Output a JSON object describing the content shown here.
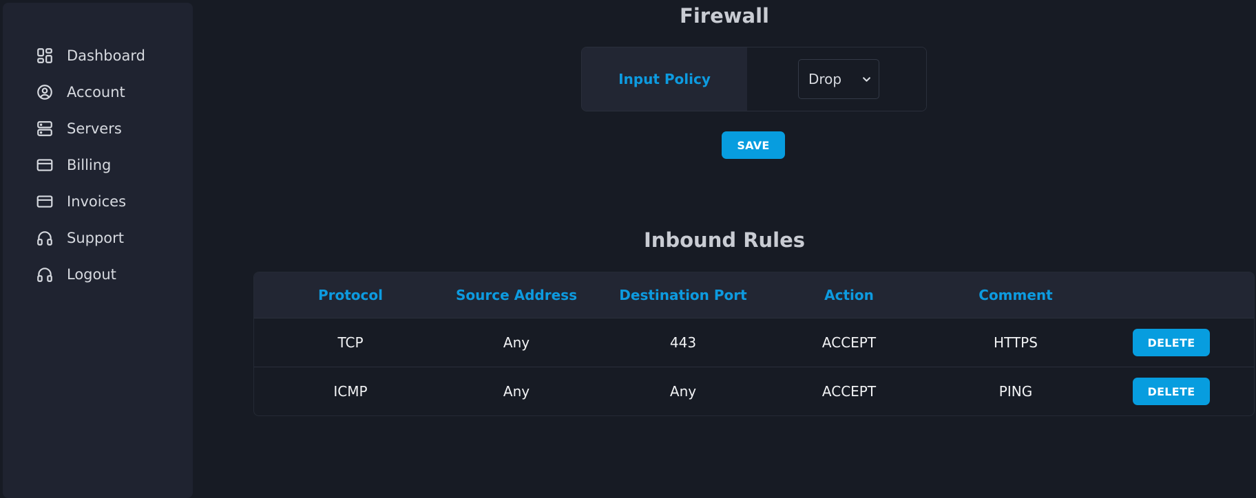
{
  "sidebar": {
    "items": [
      {
        "label": "Dashboard",
        "icon": "dashboard-icon"
      },
      {
        "label": "Account",
        "icon": "user-circle-icon"
      },
      {
        "label": "Servers",
        "icon": "server-icon"
      },
      {
        "label": "Billing",
        "icon": "credit-card-icon"
      },
      {
        "label": "Invoices",
        "icon": "credit-card-icon"
      },
      {
        "label": "Support",
        "icon": "headphones-icon"
      },
      {
        "label": "Logout",
        "icon": "headphones-icon"
      }
    ]
  },
  "firewall": {
    "title": "Firewall",
    "policy_label": "Input Policy",
    "policy_value": "Drop",
    "save_label": "SAVE"
  },
  "inbound": {
    "title": "Inbound Rules",
    "columns": [
      "Protocol",
      "Source Address",
      "Destination Port",
      "Action",
      "Comment"
    ],
    "rows": [
      {
        "protocol": "TCP",
        "source": "Any",
        "port": "443",
        "action": "ACCEPT",
        "comment": "HTTPS",
        "delete_label": "DELETE"
      },
      {
        "protocol": "ICMP",
        "source": "Any",
        "port": "Any",
        "action": "ACCEPT",
        "comment": "PING",
        "delete_label": "DELETE"
      }
    ]
  },
  "colors": {
    "accent": "#079ddf",
    "background": "#171b24",
    "sidebar": "#1f2330"
  }
}
